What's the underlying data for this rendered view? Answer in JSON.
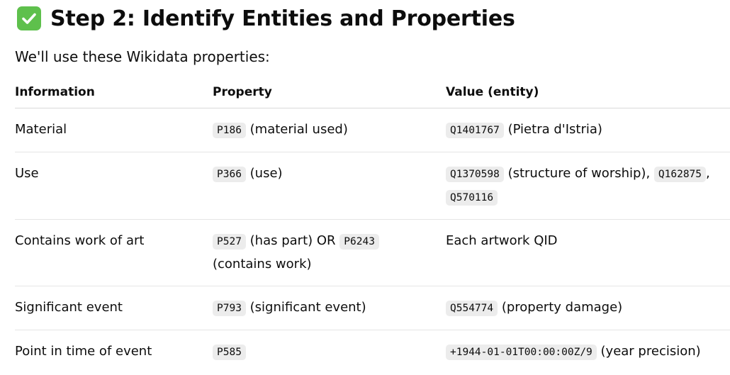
{
  "heading": {
    "icon": "check-mark-button-icon",
    "icon_color": "#5ec04c",
    "text": "Step 2: Identify Entities and Properties"
  },
  "intro": "We'll use these Wikidata properties:",
  "table": {
    "headers": [
      "Information",
      "Property",
      "Value (entity)"
    ],
    "rows": [
      {
        "information": "Material",
        "property_code": "P186",
        "property_text": "(material used)",
        "value_code": "Q1401767",
        "value_text": "(Pietra d'Istria)"
      },
      {
        "information": "Use",
        "property_code": "P366",
        "property_text": "(use)",
        "value_code_1": "Q1370598",
        "value_text_1": "(structure of worship),",
        "value_code_2": "Q162875",
        "value_sep": ",",
        "value_code_3": "Q570116"
      },
      {
        "information": "Contains work of art",
        "property_code_1": "P527",
        "property_text_1": "(has part) OR",
        "property_code_2": "P6243",
        "property_text_2": "(contains work)",
        "value_text": "Each artwork QID"
      },
      {
        "information": "Significant event",
        "property_code": "P793",
        "property_text": "(significant event)",
        "value_code": "Q554774",
        "value_text": "(property damage)"
      },
      {
        "information": "Point in time of event",
        "property_code": "P585",
        "value_code": "+1944-01-01T00:00:00Z/9",
        "value_text": "(year precision)"
      }
    ]
  }
}
